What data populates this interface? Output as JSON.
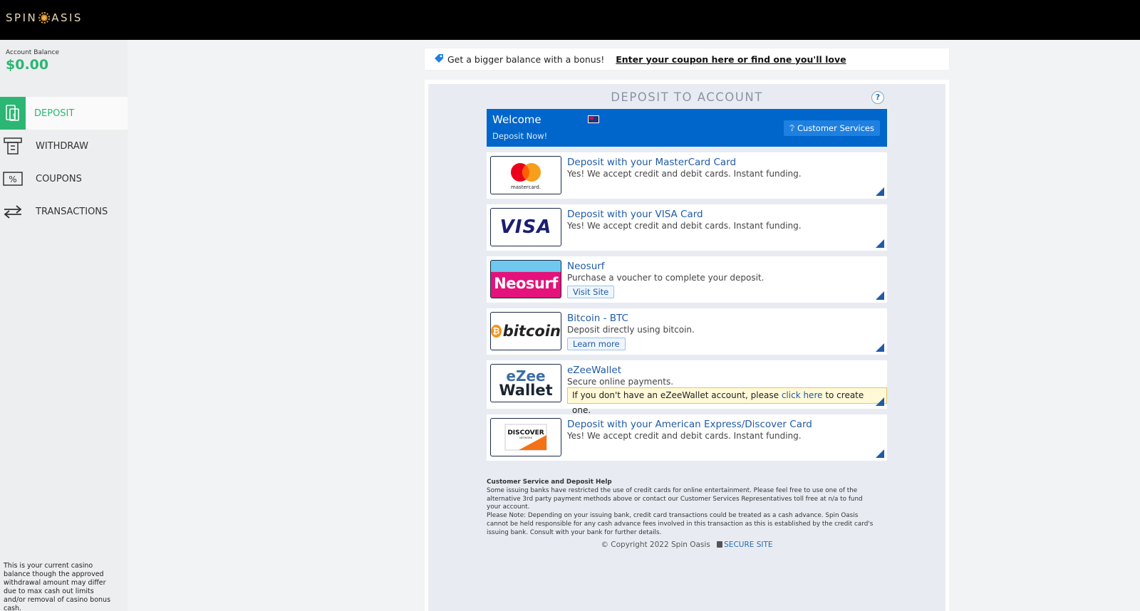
{
  "header": {
    "logo_text": "SPIN OASIS"
  },
  "sidebar": {
    "balance_label": "Account Balance",
    "balance_value": "$0.00",
    "items": [
      {
        "label": "DEPOSIT",
        "icon": "deposit-icon",
        "active": true
      },
      {
        "label": "WITHDRAW",
        "icon": "atm-icon",
        "active": false
      },
      {
        "label": "COUPONS",
        "icon": "coupon-icon",
        "active": false
      },
      {
        "label": "TRANSACTIONS",
        "icon": "transfer-arrows-icon",
        "active": false
      }
    ],
    "note": "This is your current casino balance though the approved withdrawal amount may differ due to max cash out limits and/or removal of casino bonus cash."
  },
  "coupon_bar": {
    "text": "Get a bigger balance with a bonus!",
    "link": "Enter your coupon here or find one you'll love"
  },
  "panel": {
    "title": "DEPOSIT TO ACCOUNT",
    "help": "?",
    "welcome": {
      "title": "Welcome",
      "subtitle": "Deposit Now!",
      "customer_services": "Customer Services"
    },
    "methods": [
      {
        "title": "Deposit with your MasterCard Card",
        "desc": "Yes! We accept credit and debit cards. Instant funding.",
        "logo": "mastercard",
        "logo_text": "mastercard."
      },
      {
        "title": "Deposit with your VISA Card",
        "desc": "Yes! We accept credit and debit cards. Instant funding.",
        "logo": "visa",
        "logo_text": "VISA"
      },
      {
        "title": "Neosurf",
        "desc": "Purchase a voucher to complete your deposit.",
        "logo": "neosurf",
        "logo_text": "Neosurf",
        "button": "Visit Site"
      },
      {
        "title": "Bitcoin - BTC",
        "desc": "Deposit directly using bitcoin.",
        "logo": "bitcoin",
        "logo_text": "bitcoin",
        "button": "Learn more"
      },
      {
        "title": "eZeeWallet",
        "desc": "Secure online payments.",
        "logo": "ezeewallet",
        "logo_text_1": "eZee",
        "logo_text_2": "Wallet",
        "note_prefix": "If you don't have an eZeeWallet account, please ",
        "note_link": "click here",
        "note_suffix": " to create one."
      },
      {
        "title": "Deposit with your American Express/Discover Card",
        "desc": "Yes! We accept credit and debit cards. Instant funding.",
        "logo": "discover",
        "logo_text": "DISCOVER",
        "logo_subtext": "NETWORK"
      }
    ],
    "help_title": "Customer Service and Deposit Help",
    "help_p1": "Some issuing banks have restricted the use of credit cards for online entertainment. Please feel free to use one of the alternative 3rd party payment methods above or contact our Customer Services Representatives toll free at n/a to fund your account.",
    "help_p2": "Please Note: Depending on your issuing bank, credit card transactions could be treated as a cash advance. Spin Oasis cannot be held responsible for any cash advance fees involved in this transaction as this is established by the credit card's issuing bank. Consult with your bank for further details.",
    "copyright": "© Copyright 2022 Spin Oasis",
    "secure": "SECURE SITE"
  }
}
